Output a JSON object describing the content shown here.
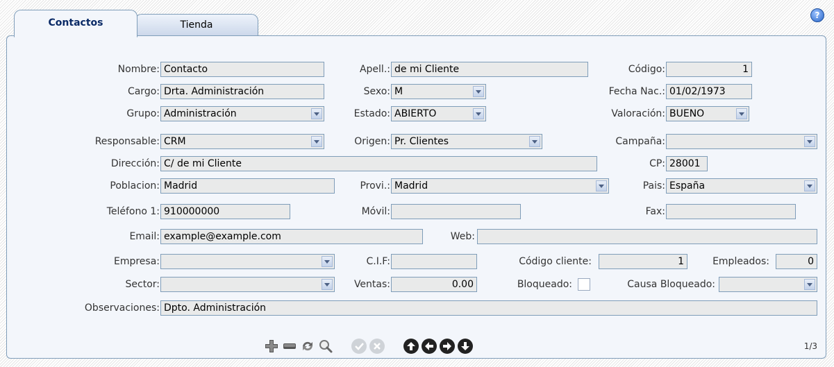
{
  "tabs": {
    "contactos": "Contactos",
    "tienda": "Tienda"
  },
  "help_icon": "?",
  "labels": {
    "nombre": "Nombre:",
    "apell": "Apell.:",
    "codigo": "Código:",
    "cargo": "Cargo:",
    "sexo": "Sexo:",
    "fecha_nac": "Fecha Nac.:",
    "grupo": "Grupo:",
    "estado": "Estado:",
    "valoracion": "Valoración:",
    "responsable": "Responsable:",
    "origen": "Origen:",
    "campana": "Campaña:",
    "direccion": "Dirección:",
    "cp": "CP:",
    "poblacion": "Poblacion:",
    "provi": "Provi.:",
    "pais": "Pais:",
    "telefono1": "Teléfono 1:",
    "movil": "Móvil:",
    "fax": "Fax:",
    "email": "Email:",
    "web": "Web:",
    "empresa": "Empresa:",
    "cif": "C.I.F:",
    "codigo_cliente": "Código cliente:",
    "empleados": "Empleados:",
    "sector": "Sector:",
    "ventas": "Ventas:",
    "bloqueado": "Bloqueado:",
    "causa_bloqueado": "Causa Bloqueado:",
    "observaciones": "Observaciones:"
  },
  "fields": {
    "nombre": "Contacto",
    "apell": "de mi Cliente",
    "codigo": "1",
    "cargo": "Drta. Administración",
    "sexo": "M",
    "fecha_nac": "01/02/1973",
    "grupo": "Administración",
    "estado": "ABIERTO",
    "valoracion": "BUENO",
    "responsable": "CRM",
    "origen": "Pr. Clientes",
    "campana": "",
    "direccion": "C/ de mi Cliente",
    "cp": "28001",
    "poblacion": "Madrid",
    "provi": "Madrid",
    "pais": "España",
    "telefono1": "910000000",
    "movil": "",
    "fax": "",
    "email": "example@example.com",
    "web": "",
    "empresa": "",
    "cif": "",
    "codigo_cliente": "1",
    "empleados": "0",
    "sector": "",
    "ventas": "0.00",
    "bloqueado": false,
    "causa_bloqueado": "",
    "observaciones": "Dpto. Administración"
  },
  "toolbar": {
    "icons": [
      "add-icon",
      "remove-icon",
      "refresh-icon",
      "search-icon",
      "confirm-icon",
      "cancel-icon",
      "arrow-up-icon",
      "arrow-left-icon",
      "arrow-right-icon",
      "arrow-down-icon"
    ]
  },
  "pager": "1/3",
  "colors": {
    "panel_bg": "#f3f6fb",
    "border": "#7f9db9",
    "field_bg": "#e9eaea",
    "title_blue": "#0a2a66"
  }
}
